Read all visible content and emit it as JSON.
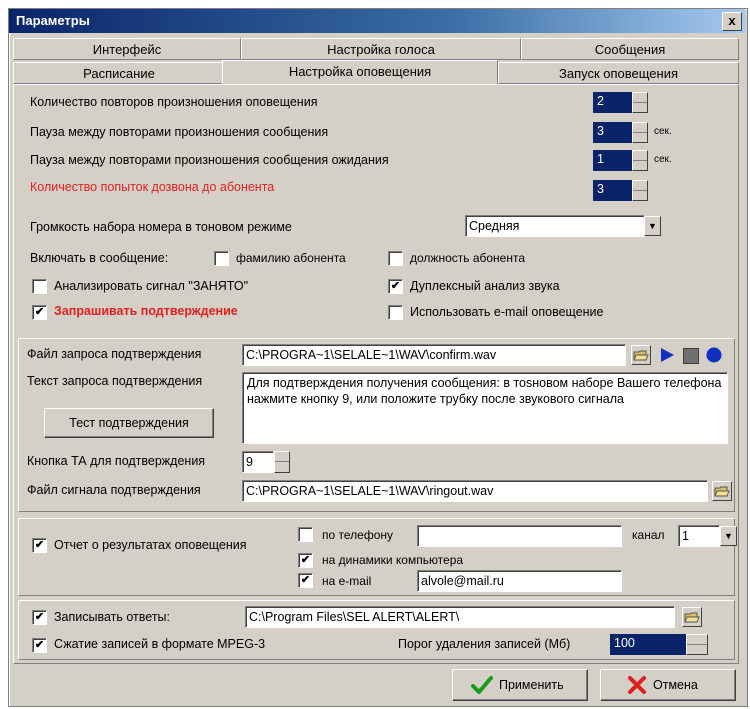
{
  "window": {
    "title": "Параметры",
    "close": "x"
  },
  "tabs_row1": [
    "Интерфейс",
    "Настройка голоса",
    "Сообщения"
  ],
  "tabs_row2": [
    "Расписание",
    "Настройка оповещения",
    "Запуск оповещения"
  ],
  "settings": {
    "repeats_label": "Количество повторов произношения оповещения",
    "repeats_value": "2",
    "pause_msg_label": "Пауза между повторами произношения сообщения",
    "pause_msg_value": "3",
    "pause_msg_unit": "сек.",
    "pause_wait_label": "Пауза между повторами произношения сообщения ожидания",
    "pause_wait_value": "1",
    "pause_wait_unit": "сек.",
    "attempts_label": "Количество попыток дозвона до абонента",
    "attempts_value": "3",
    "volume_label": "Громкость набора номера в тоновом режиме",
    "volume_value": "Средняя",
    "include_label": "Включать в сообщение:",
    "surname_label": "фамилию абонента",
    "position_label": "должность абонента",
    "busy_label": "Анализировать сигнал \"ЗАНЯТО\"",
    "duplex_label": "Дуплексный анализ звука",
    "confirm_label": "Запрашивать подтверждение",
    "email_notify_label": "Использовать e-mail оповещение"
  },
  "confirm": {
    "file_label": "Файл запроса подтверждения",
    "file_value": "C:\\PROGRA~1\\SELALE~1\\WAV\\confirm.wav",
    "text_label": "Текст запроса подтверждения",
    "text_value": "Для подтверждения получения сообщения: в тоsновом наборе Вашего телефона нажмите кнопку 9, или положите трубку после звукового сигнала",
    "test_button": "Тест подтверждения",
    "key_label": "Кнопка ТА для подтверждения",
    "key_value": "9",
    "signal_label": "Файл сигнала подтверждения",
    "signal_value": "C:\\PROGRA~1\\SELALE~1\\WAV\\ringout.wav"
  },
  "report": {
    "label": "Отчет о результатах оповещения",
    "phone_label": "по телефону",
    "phone_value": "",
    "channel_label": "канал",
    "channel_value": "1",
    "speakers_label": "на динамики компьютера",
    "email_label": "на e-mail",
    "email_value": "alvole@mail.ru"
  },
  "record": {
    "label": "Записывать ответы:",
    "path_value": "C:\\Program Files\\SEL ALERT\\ALERT\\",
    "mpeg_label": "Сжатие записей в формате MPEG-3",
    "threshold_label": "Порог удаления записей (Мб)",
    "threshold_value": "100"
  },
  "buttons": {
    "apply": "Применить",
    "cancel": "Отмена"
  },
  "colors": {
    "title_start": "#0a246a",
    "spin_bg": "#0a246a",
    "warn": "#e02020",
    "apply_check": "#1a9a1a",
    "cancel_x": "#e02020"
  }
}
